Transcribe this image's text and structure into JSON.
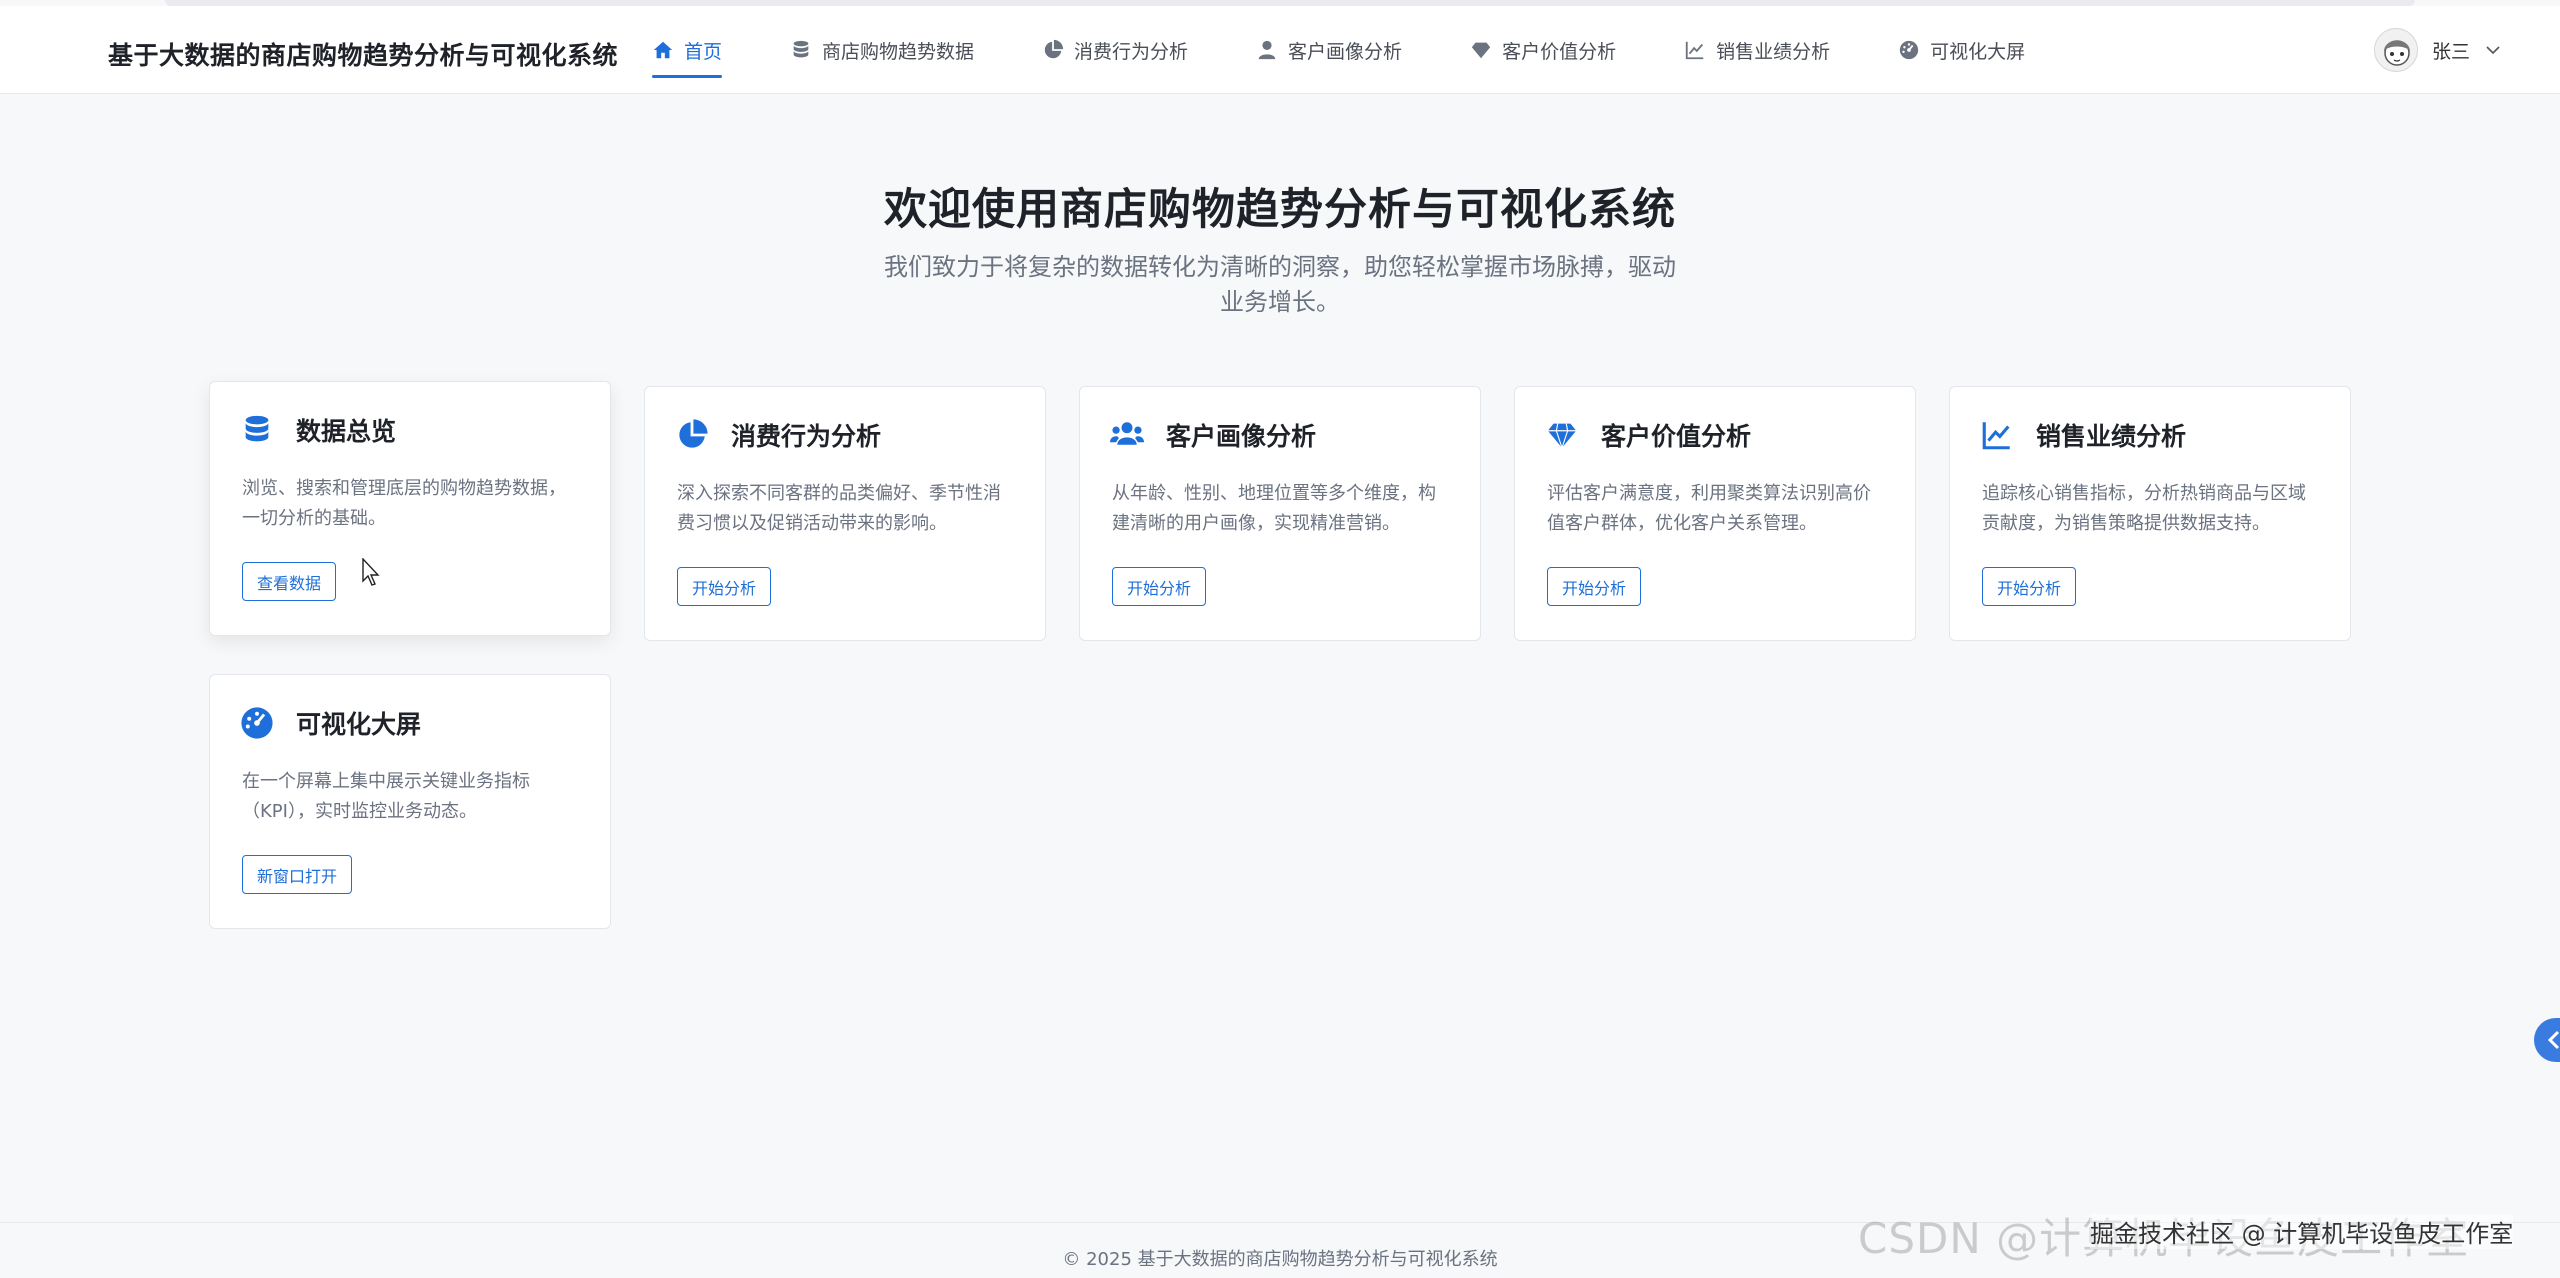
{
  "app": {
    "brand": "基于大数据的商店购物趋势分析与可视化系统"
  },
  "nav": {
    "items": [
      {
        "label": "首页",
        "icon": "home-icon",
        "active": true
      },
      {
        "label": "商店购物趋势数据",
        "icon": "database-icon",
        "active": false
      },
      {
        "label": "消费行为分析",
        "icon": "pie-chart-icon",
        "active": false
      },
      {
        "label": "客户画像分析",
        "icon": "user-icon",
        "active": false
      },
      {
        "label": "客户价值分析",
        "icon": "diamond-icon",
        "active": false
      },
      {
        "label": "销售业绩分析",
        "icon": "line-chart-icon",
        "active": false
      },
      {
        "label": "可视化大屏",
        "icon": "dashboard-icon",
        "active": false
      }
    ]
  },
  "user": {
    "name": "张三"
  },
  "hero": {
    "title": "欢迎使用商店购物趋势分析与可视化系统",
    "subtitle": "我们致力于将复杂的数据转化为清晰的洞察，助您轻松掌握市场脉搏，驱动业务增长。"
  },
  "cards": [
    {
      "title": "数据总览",
      "icon": "database-icon",
      "desc": "浏览、搜索和管理底层的购物趋势数据，一切分析的基础。",
      "button": "查看数据"
    },
    {
      "title": "消费行为分析",
      "icon": "pie-chart-icon",
      "desc": "深入探索不同客群的品类偏好、季节性消费习惯以及促销活动带来的影响。",
      "button": "开始分析"
    },
    {
      "title": "客户画像分析",
      "icon": "users-icon",
      "desc": "从年龄、性别、地理位置等多个维度，构建清晰的用户画像，实现精准营销。",
      "button": "开始分析"
    },
    {
      "title": "客户价值分析",
      "icon": "diamond-icon",
      "desc": "评估客户满意度，利用聚类算法识别高价值客户群体，优化客户关系管理。",
      "button": "开始分析"
    },
    {
      "title": "销售业绩分析",
      "icon": "line-chart-icon",
      "desc": "追踪核心销售指标，分析热销商品与区域贡献度，为销售策略提供数据支持。",
      "button": "开始分析"
    },
    {
      "title": "可视化大屏",
      "icon": "dashboard-icon",
      "desc": "在一个屏幕上集中展示关键业务指标（KPI），实时监控业务动态。",
      "button": "新窗口打开"
    }
  ],
  "footer": {
    "copyright": "© 2025 基于大数据的商店购物趋势分析与可视化系统"
  },
  "watermark": {
    "csdn": "CSDN @计算机毕设鱼皮工作室",
    "juejin": "掘金技术社区 @ 计算机毕设鱼皮工作室"
  },
  "colors": {
    "accent": "#1e6fd9",
    "background": "#f6f8fa"
  }
}
